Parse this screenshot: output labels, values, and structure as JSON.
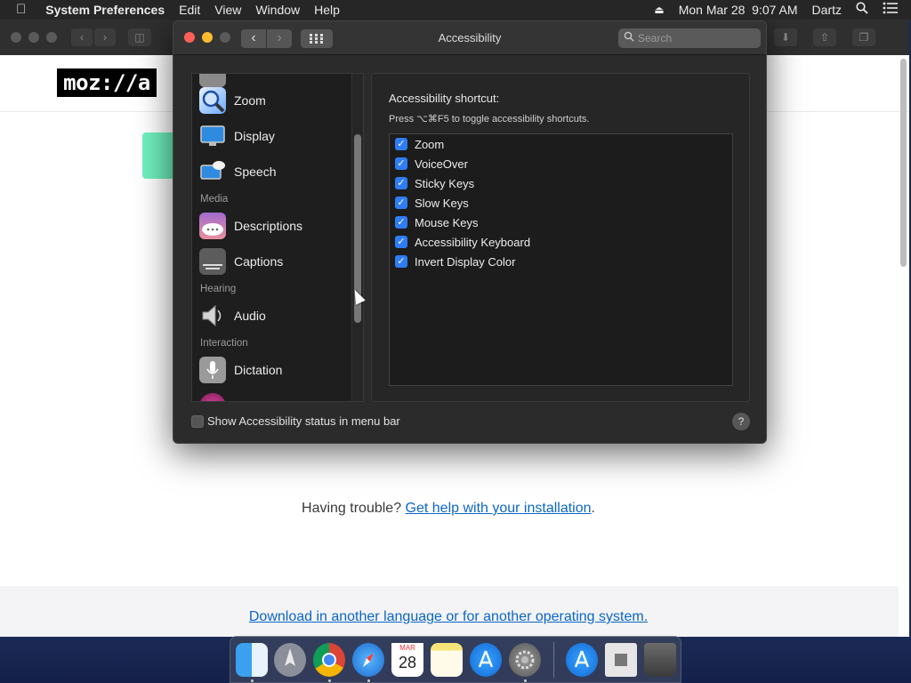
{
  "menubar": {
    "apple_icon": "apple-icon",
    "app_name": "System Preferences",
    "menus": [
      "Edit",
      "View",
      "Window",
      "Help"
    ],
    "clock": "Mon Mar 28  9:07 AM",
    "user": "Dartz",
    "right_icons": [
      "eject-icon",
      "search-icon",
      "list-icon"
    ]
  },
  "browser": {
    "logo_text": "moz://a",
    "trouble_text": "Having trouble? ",
    "help_link": "Get help with your installation",
    "trouble_suffix": ".",
    "download_link": "Download in another language or for another operating system."
  },
  "prefs": {
    "title": "Accessibility",
    "search_placeholder": "Search",
    "sidebar": [
      {
        "type": "item",
        "label": "Zoom",
        "icon": "zoom-icon"
      },
      {
        "type": "item",
        "label": "Display",
        "icon": "display-icon"
      },
      {
        "type": "item",
        "label": "Speech",
        "icon": "speech-icon"
      },
      {
        "type": "header",
        "label": "Media"
      },
      {
        "type": "item",
        "label": "Descriptions",
        "icon": "descriptions-icon"
      },
      {
        "type": "item",
        "label": "Captions",
        "icon": "captions-icon"
      },
      {
        "type": "header",
        "label": "Hearing"
      },
      {
        "type": "item",
        "label": "Audio",
        "icon": "audio-icon"
      },
      {
        "type": "header",
        "label": "Interaction"
      },
      {
        "type": "item",
        "label": "Dictation",
        "icon": "dictation-icon"
      }
    ],
    "panel": {
      "heading": "Accessibility shortcut:",
      "subheading": "Press ⌥⌘F5 to toggle accessibility shortcuts.",
      "options": [
        {
          "label": "Zoom",
          "checked": true
        },
        {
          "label": "VoiceOver",
          "checked": true
        },
        {
          "label": "Sticky Keys",
          "checked": true
        },
        {
          "label": "Slow Keys",
          "checked": true
        },
        {
          "label": "Mouse Keys",
          "checked": true
        },
        {
          "label": "Accessibility Keyboard",
          "checked": true
        },
        {
          "label": "Invert Display Color",
          "checked": true
        }
      ]
    },
    "status_label": "Show Accessibility status in menu bar",
    "status_checked": false,
    "help_label": "?"
  },
  "dock": [
    "finder-icon",
    "launchpad-icon",
    "chrome-icon",
    "safari-icon",
    "calendar-icon",
    "notes-icon",
    "app-store-icon",
    "system-preferences-icon",
    "app-store-download-icon",
    "file-icon",
    "trash-icon"
  ],
  "calendar_month": "MAR",
  "calendar_day": "28",
  "colors": {
    "accent": "#2f7df4",
    "link": "#0b66c6",
    "mozilla_green": "#6ef0be"
  }
}
